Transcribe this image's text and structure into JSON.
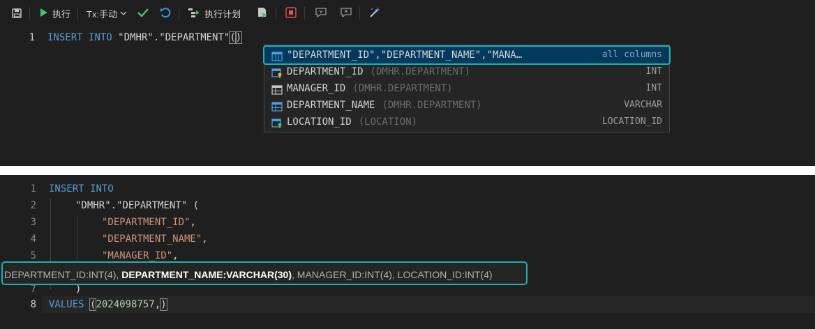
{
  "toolbar": {
    "run_label": "执行",
    "tx_label": "Tx:手动",
    "plan_label": "执行计划"
  },
  "editor_top": {
    "line_number": "1",
    "code": {
      "kw1": "INSERT",
      "kw2": "INTO",
      "schema": "\"DMHR\"",
      "dot": ".",
      "table": "\"DEPARTMENT\"",
      "open": "(",
      "close": ")"
    }
  },
  "suggestions": [
    {
      "label": "\"DEPARTMENT_ID\",\"DEPARTMENT_NAME\",\"MANA…",
      "desc": "",
      "type": "all columns",
      "icon": "columns-icon"
    },
    {
      "label": "DEPARTMENT_ID",
      "desc": "(DMHR.DEPARTMENT)",
      "type": "INT",
      "icon": "key-column-icon"
    },
    {
      "label": "MANAGER_ID",
      "desc": "(DMHR.DEPARTMENT)",
      "type": "INT",
      "icon": "column-icon"
    },
    {
      "label": "DEPARTMENT_NAME",
      "desc": "(DMHR.DEPARTMENT)",
      "type": "VARCHAR",
      "icon": "column-icon"
    },
    {
      "label": "LOCATION_ID",
      "desc": "(LOCATION)",
      "type": "LOCATION_ID",
      "icon": "key-column-icon"
    }
  ],
  "editor_bottom": {
    "line_numbers": [
      "1",
      "2",
      "3",
      "4",
      "5",
      "7",
      "8"
    ],
    "l1_kw1": "INSERT",
    "l1_kw2": "INTO",
    "l2_schema": "\"DMHR\"",
    "l2_dot": ".",
    "l2_table": "\"DEPARTMENT\"",
    "l2_paren": " (",
    "l3": "\"DEPARTMENT_ID\"",
    "l3_comma": ",",
    "l4": "\"DEPARTMENT_NAME\"",
    "l4_comma": ",",
    "l5": "\"MANAGER_ID\"",
    "l5_comma": ",",
    "l7": ")",
    "l8_kw": "VALUES",
    "l8_open": "(",
    "l8_num": "2024098757",
    "l8_comma": ",",
    "l8_close": ")"
  },
  "param_hint": {
    "p1": "DEPARTMENT_ID:INT(4), ",
    "p2": "DEPARTMENT_NAME:VARCHAR(30)",
    "p3": ", MANAGER_ID:INT(4), LOCATION_ID:INT(4)"
  },
  "colors": {
    "accent": "#1bb3b5",
    "keyword": "#569cd6",
    "string": "#ce9178",
    "number": "#b5cea8"
  }
}
